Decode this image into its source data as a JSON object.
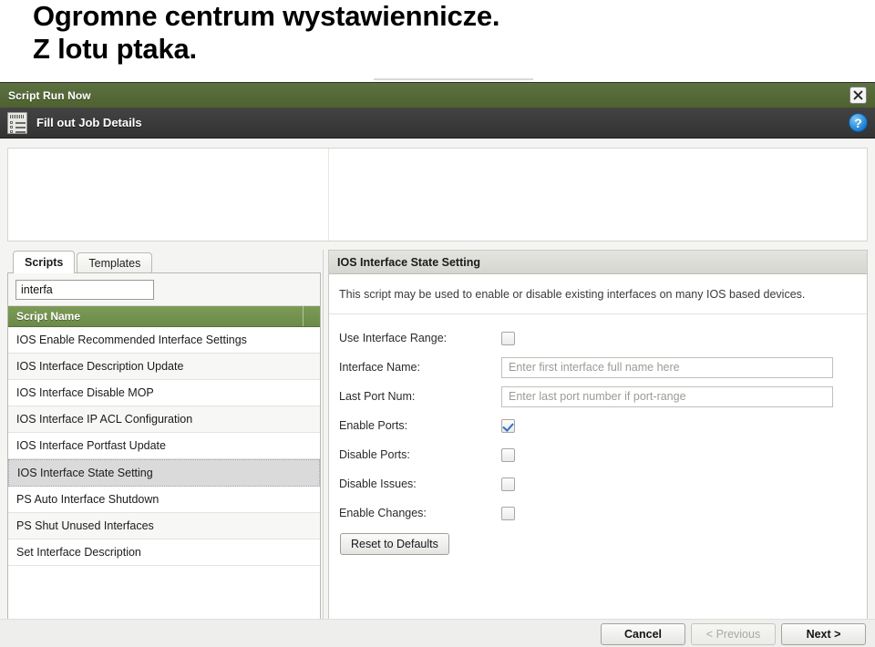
{
  "slide": {
    "heading_line1": "Ogromne centrum wystawiennicze.",
    "heading_line2": "Z lotu ptaka."
  },
  "window": {
    "title": "Script Run Now",
    "close_icon": "close-icon",
    "subtitle": "Fill out Job Details",
    "subtitle_icon": "form-checklist-icon",
    "help_icon": "?"
  },
  "left_pane": {
    "tabs": [
      {
        "label": "Scripts",
        "active": true
      },
      {
        "label": "Templates",
        "active": false
      }
    ],
    "search": {
      "value": "interfa",
      "placeholder": ""
    },
    "column_header": "Script Name",
    "items": [
      {
        "label": "IOS Enable Recommended Interface Settings",
        "selected": false
      },
      {
        "label": "IOS Interface Description Update",
        "selected": false
      },
      {
        "label": "IOS Interface Disable MOP",
        "selected": false
      },
      {
        "label": "IOS Interface IP ACL Configuration",
        "selected": false
      },
      {
        "label": "IOS Interface Portfast Update",
        "selected": false
      },
      {
        "label": "IOS Interface State Setting",
        "selected": true
      },
      {
        "label": "PS Auto Interface Shutdown",
        "selected": false
      },
      {
        "label": "PS Shut Unused Interfaces",
        "selected": false
      },
      {
        "label": "Set Interface Description",
        "selected": false
      }
    ]
  },
  "right_pane": {
    "title": "IOS Interface State Setting",
    "description": "This script may be used to enable or disable existing interfaces on many IOS based devices.",
    "fields": [
      {
        "label": "Use Interface Range:",
        "type": "checkbox",
        "checked": false
      },
      {
        "label": "Interface Name:",
        "type": "text",
        "value": "",
        "placeholder": "Enter first interface full name here"
      },
      {
        "label": "Last Port Num:",
        "type": "text",
        "value": "",
        "placeholder": "Enter last port number if port-range"
      },
      {
        "label": "Enable Ports:",
        "type": "checkbox",
        "checked": true
      },
      {
        "label": "Disable Ports:",
        "type": "checkbox",
        "checked": false
      },
      {
        "label": "Disable Issues:",
        "type": "checkbox",
        "checked": false
      },
      {
        "label": "Enable Changes:",
        "type": "checkbox",
        "checked": false
      }
    ],
    "reset_button": "Reset to Defaults"
  },
  "footer": {
    "cancel": "Cancel",
    "previous": "< Previous",
    "next": "Next >"
  },
  "colors": {
    "titlebar_green": "#566b38",
    "column_header_green": "#74934f",
    "subbar_dark": "#3b3b3b",
    "help_blue": "#1b7fd4",
    "selection_gray": "#dadada"
  }
}
